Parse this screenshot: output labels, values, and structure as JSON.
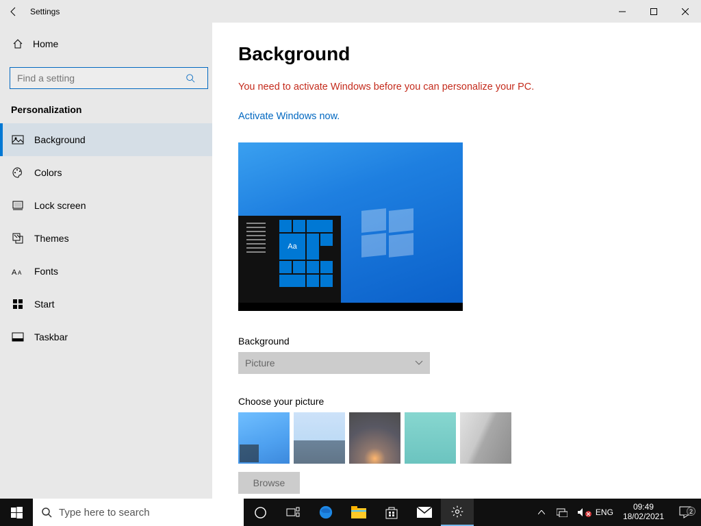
{
  "titlebar": {
    "title": "Settings"
  },
  "sidebar": {
    "home_label": "Home",
    "search_placeholder": "Find a setting",
    "section": "Personalization",
    "items": [
      {
        "label": "Background"
      },
      {
        "label": "Colors"
      },
      {
        "label": "Lock screen"
      },
      {
        "label": "Themes"
      },
      {
        "label": "Fonts"
      },
      {
        "label": "Start"
      },
      {
        "label": "Taskbar"
      }
    ]
  },
  "main": {
    "title": "Background",
    "warning": "You need to activate Windows before you can personalize your PC.",
    "activate_link": "Activate Windows now.",
    "preview_tile_text": "Aa",
    "bg_label": "Background",
    "bg_dropdown_value": "Picture",
    "choose_label": "Choose your picture",
    "browse_label": "Browse"
  },
  "taskbar": {
    "search_placeholder": "Type here to search",
    "lang": "ENG",
    "time": "09:49",
    "date": "18/02/2021",
    "notification_count": "2"
  }
}
